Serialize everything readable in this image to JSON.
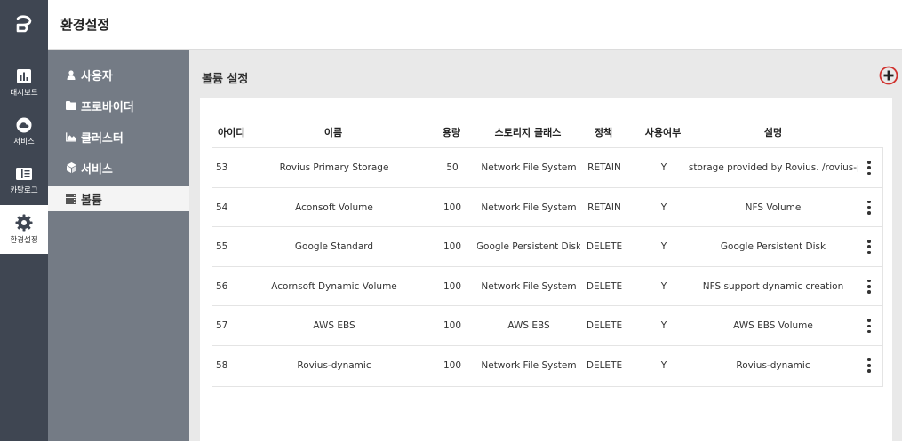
{
  "header": {
    "title": "환경설정"
  },
  "rail": {
    "items": [
      {
        "label": "대시보드",
        "icon": "bar-chart-icon"
      },
      {
        "label": "서비스",
        "icon": "cloud-icon"
      },
      {
        "label": "카탈로그",
        "icon": "book-icon"
      },
      {
        "label": "환경설정",
        "icon": "gear-icon",
        "active": true
      }
    ]
  },
  "subnav": {
    "items": [
      {
        "label": "사용자",
        "icon": "user-icon"
      },
      {
        "label": "프로바이더",
        "icon": "folder-icon"
      },
      {
        "label": "클러스터",
        "icon": "area-chart-icon"
      },
      {
        "label": "서비스",
        "icon": "cube-icon"
      },
      {
        "label": "볼륨",
        "icon": "server-icon",
        "active": true
      }
    ]
  },
  "main": {
    "title": "볼륨 설정",
    "add_icon": "plus-circle-icon",
    "accent": "#d0312d"
  },
  "table": {
    "headers": [
      "아이디",
      "이름",
      "용량",
      "스토리지 클래스",
      "정책",
      "사용여부",
      "설명"
    ],
    "rows": [
      [
        "53",
        "Rovius Primary Storage",
        "50",
        "Network File System",
        "RETAIN",
        "Y",
        "The storage provided by Rovius. /rovius-pri..."
      ],
      [
        "54",
        "Aconsoft Volume",
        "100",
        "Network File System",
        "RETAIN",
        "Y",
        "NFS Volume"
      ],
      [
        "55",
        "Google Standard",
        "100",
        "Google Persistent Disk",
        "DELETE",
        "Y",
        "Google Persistent Disk"
      ],
      [
        "56",
        "Acornsoft Dynamic Volume",
        "100",
        "Network File System",
        "DELETE",
        "Y",
        "NFS support dynamic creation"
      ],
      [
        "57",
        "AWS EBS",
        "100",
        "AWS EBS",
        "DELETE",
        "Y",
        "AWS EBS Volume"
      ],
      [
        "58",
        "Rovius-dynamic",
        "100",
        "Network File System",
        "DELETE",
        "Y",
        "Rovius-dynamic"
      ]
    ]
  }
}
